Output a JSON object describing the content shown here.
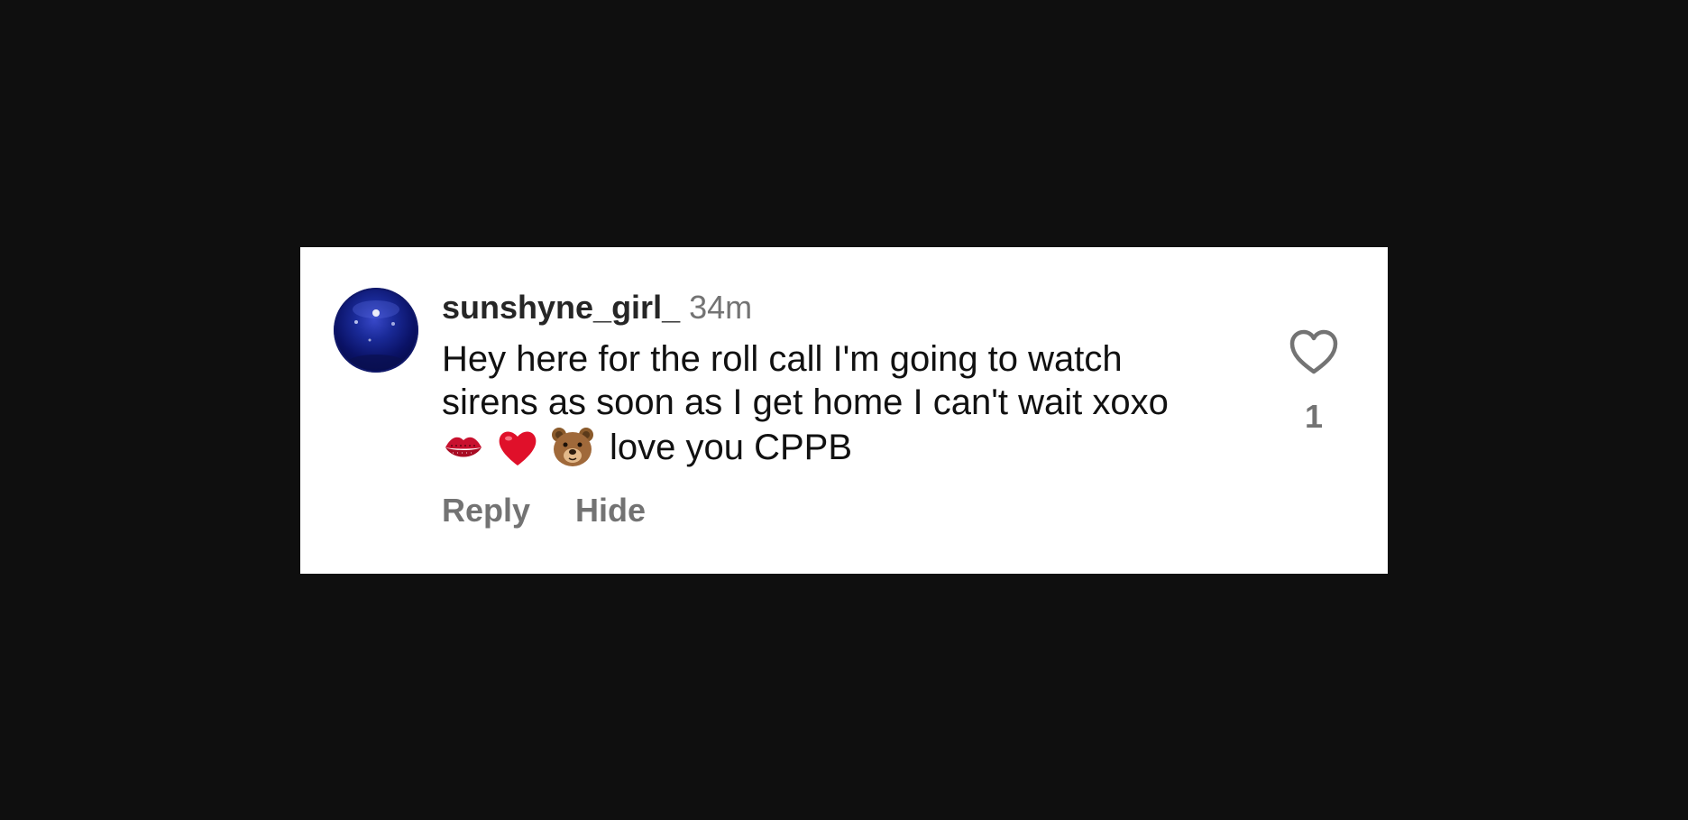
{
  "comment": {
    "username": "sunshyne_girl_",
    "timestamp": "34m",
    "text_lines": [
      "Hey here for the roll call I'm going to watch",
      "sirens as soon as I get home I can't wait xoxo"
    ],
    "emojis": [
      "kiss-mark",
      "red-heart",
      "bear-face"
    ],
    "text_tail": "love you CPPB",
    "avatar_icon": "blue-sphere",
    "like_icon": "heart-outline-icon",
    "like_count": "1",
    "actions": {
      "reply_label": "Reply",
      "hide_label": "Hide"
    }
  },
  "colors": {
    "background": "#0f0f0f",
    "card": "#ffffff",
    "username": "#262626",
    "secondary_text": "#737373",
    "body_text": "#111111"
  }
}
